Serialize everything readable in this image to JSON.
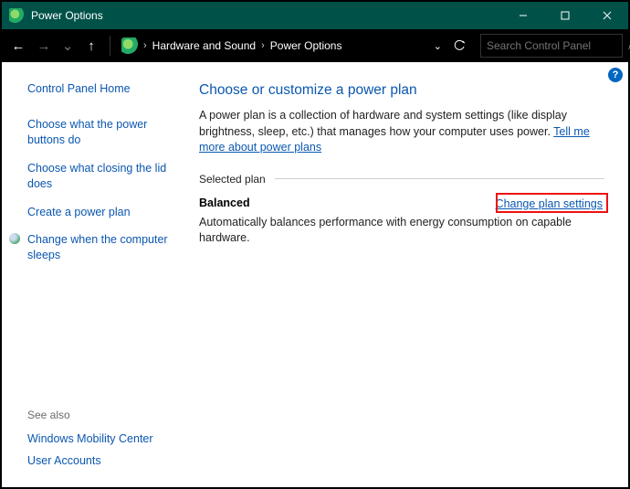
{
  "titlebar": {
    "title": "Power Options"
  },
  "breadcrumb": {
    "seg1": "Hardware and Sound",
    "seg2": "Power Options"
  },
  "search": {
    "placeholder": "Search Control Panel"
  },
  "sidebar": {
    "home": "Control Panel Home",
    "links": [
      "Choose what the power buttons do",
      "Choose what closing the lid does",
      "Create a power plan",
      "Change when the computer sleeps"
    ],
    "seealso_header": "See also",
    "seealso": [
      "Windows Mobility Center",
      "User Accounts"
    ]
  },
  "main": {
    "heading": "Choose or customize a power plan",
    "desc_pre": "A power plan is a collection of hardware and system settings (like display brightness, sleep, etc.) that manages how your computer uses power. ",
    "desc_link": "Tell me more about power plans",
    "selected_label": "Selected plan",
    "plan": {
      "name": "Balanced",
      "change": "Change plan settings",
      "desc": "Automatically balances performance with energy consumption on capable hardware."
    }
  },
  "help": "?"
}
